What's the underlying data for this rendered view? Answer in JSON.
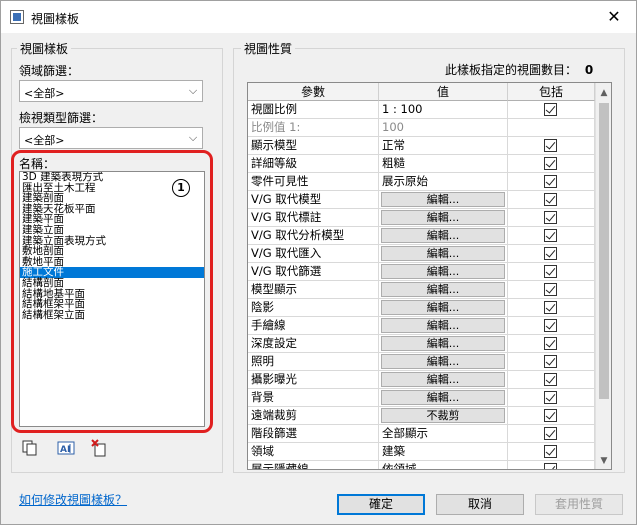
{
  "window": {
    "title": "視圖樣板",
    "close_glyph": "✕"
  },
  "left": {
    "group_title": "視圖樣板",
    "discipline_filter": {
      "label": "領域篩選：",
      "value": "<全部>"
    },
    "type_filter": {
      "label": "檢視類型篩選：",
      "value": "<全部>"
    },
    "names": {
      "label": "名稱：",
      "items": [
        "3D 建築表現方式",
        "匯出至土木工程",
        "建築剖面",
        "建築天花板平面",
        "建築平面",
        "建築立面",
        "建築立面表現方式",
        "敷地剖面",
        "敷地平面",
        "施工文件",
        "結構剖面",
        "結構地基平面",
        "結構框架平面",
        "結構框架立面"
      ],
      "selected_index": 9,
      "badge": "1"
    }
  },
  "right": {
    "group_title": "視圖性質",
    "count_label": "此樣板指定的視圖數目：",
    "count_value": "0",
    "headers": {
      "param": "參數",
      "value": "值",
      "include": "包括"
    },
    "rows": [
      {
        "param": "視圖比例",
        "value": "1 : 100",
        "kind": "text",
        "check": true
      },
      {
        "param": "比例值 1:",
        "value": "100",
        "kind": "text",
        "check": false,
        "disabled": true
      },
      {
        "param": "顯示模型",
        "value": "正常",
        "kind": "text",
        "check": true
      },
      {
        "param": "詳細等級",
        "value": "粗糙",
        "kind": "text",
        "check": true
      },
      {
        "param": "零件可見性",
        "value": "展示原始",
        "kind": "text",
        "check": true
      },
      {
        "param": "V/G 取代模型",
        "value": "編輯...",
        "kind": "button",
        "check": true
      },
      {
        "param": "V/G 取代標註",
        "value": "編輯...",
        "kind": "button",
        "check": true
      },
      {
        "param": "V/G 取代分析模型",
        "value": "編輯...",
        "kind": "button",
        "check": true
      },
      {
        "param": "V/G 取代匯入",
        "value": "編輯...",
        "kind": "button",
        "check": true
      },
      {
        "param": "V/G 取代篩選",
        "value": "編輯...",
        "kind": "button",
        "check": true
      },
      {
        "param": "模型顯示",
        "value": "編輯...",
        "kind": "button",
        "check": true
      },
      {
        "param": "陰影",
        "value": "編輯...",
        "kind": "button",
        "check": true
      },
      {
        "param": "手繪線",
        "value": "編輯...",
        "kind": "button",
        "check": true
      },
      {
        "param": "深度設定",
        "value": "編輯...",
        "kind": "button",
        "check": true
      },
      {
        "param": "照明",
        "value": "編輯...",
        "kind": "button",
        "check": true
      },
      {
        "param": "攝影曝光",
        "value": "編輯...",
        "kind": "button",
        "check": true
      },
      {
        "param": "背景",
        "value": "編輯...",
        "kind": "button",
        "check": true
      },
      {
        "param": "遠端裁剪",
        "value": "不裁剪",
        "kind": "button",
        "check": true
      },
      {
        "param": "階段篩選",
        "value": "全部顯示",
        "kind": "text",
        "check": true
      },
      {
        "param": "領域",
        "value": "建築",
        "kind": "text",
        "check": true
      },
      {
        "param": "展示隱藏線",
        "value": "依領域",
        "kind": "text",
        "check": true
      }
    ]
  },
  "footer": {
    "help_link": "如何修改視圖樣板？",
    "ok": "確定",
    "cancel": "取消",
    "apply": "套用性質"
  },
  "icons": {
    "duplicate": "duplicate-icon",
    "rename": "rename-icon",
    "delete": "delete-icon",
    "dropdown": "chevron-down-icon"
  }
}
